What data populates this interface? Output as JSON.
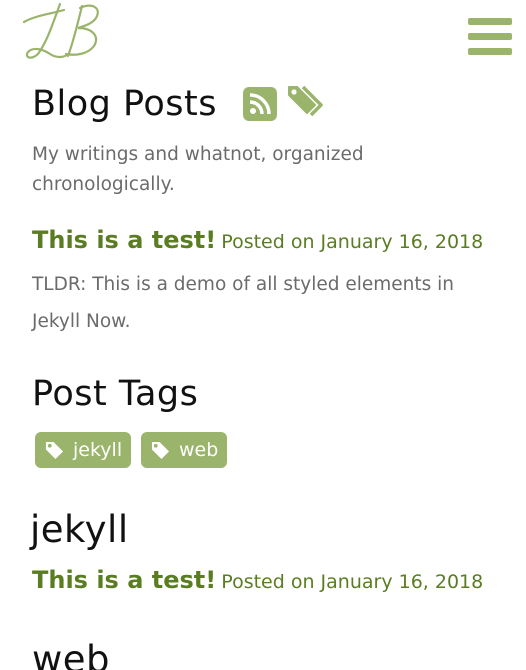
{
  "header": {
    "logo_text": "LB",
    "menu_icon": "hamburger-icon"
  },
  "main": {
    "title": "Blog Posts",
    "rss_icon": "rss-icon",
    "tags_icon": "tags-icon",
    "description": "My writings and whatnot, organized chronologically.",
    "posts": [
      {
        "title": "This is a test!",
        "date": "Posted on January 16, 2018",
        "excerpt": "TLDR: This is a demo of all styled elements in Jekyll Now."
      }
    ]
  },
  "tags_section": {
    "title": "Post Tags",
    "tags": [
      {
        "label": "jekyll",
        "icon": "tag-icon"
      },
      {
        "label": "web",
        "icon": "tag-icon"
      }
    ]
  },
  "tag_groups": [
    {
      "name": "jekyll",
      "posts": [
        {
          "title": "This is a test!",
          "date": "Posted on January 16, 2018"
        }
      ]
    },
    {
      "name": "web",
      "posts": []
    }
  ],
  "colors": {
    "accent": "#9ab46c",
    "link": "#5b7d22",
    "muted_text": "#6b6b6b"
  }
}
